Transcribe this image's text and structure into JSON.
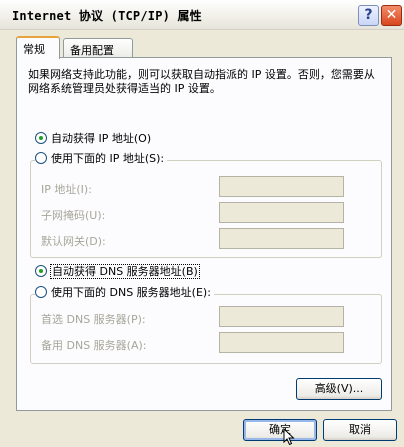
{
  "window": {
    "title": "Internet 协议 (TCP/IP) 属性",
    "help_label": "?",
    "close_label": "✕"
  },
  "tabs": [
    {
      "label": "常规",
      "active": true
    },
    {
      "label": "备用配置",
      "active": false
    }
  ],
  "description": "如果网络支持此功能，则可以获取自动指派的 IP 设置。否则，您需要从网络系统管理员处获得适当的 IP 设置。",
  "ip_section": {
    "auto_option": "自动获得 IP 地址(O)",
    "manual_option": "使用下面的 IP 地址(S):",
    "selected": "auto",
    "fields": [
      {
        "label": "IP 地址(I):",
        "value": ""
      },
      {
        "label": "子网掩码(U):",
        "value": ""
      },
      {
        "label": "默认网关(D):",
        "value": ""
      }
    ]
  },
  "dns_section": {
    "auto_option": "自动获得 DNS 服务器地址(B)",
    "manual_option": "使用下面的 DNS 服务器地址(E):",
    "selected": "auto",
    "fields": [
      {
        "label": "首选 DNS 服务器(P):",
        "value": ""
      },
      {
        "label": "备用 DNS 服务器(A):",
        "value": ""
      }
    ]
  },
  "advanced_button": "高级(V)...",
  "ok_button": "确定",
  "cancel_button": "取消",
  "colors": {
    "dialog_bg": "#ece9d8",
    "panel_bg": "#fcfcfe",
    "disabled_text": "#a7a69a",
    "radio_dot": "#21a121"
  }
}
